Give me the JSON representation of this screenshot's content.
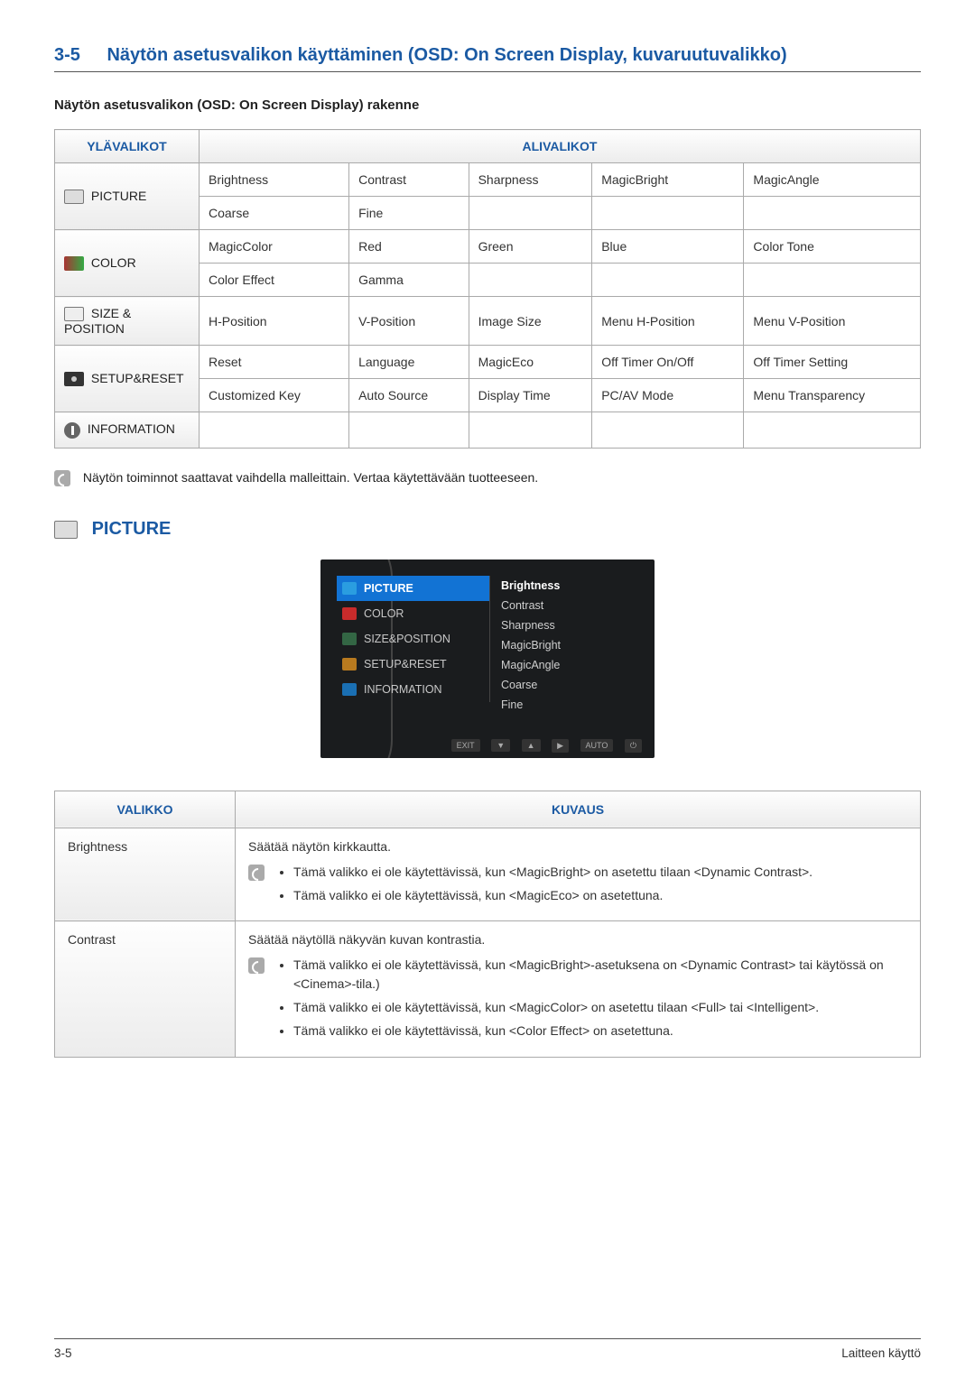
{
  "section": {
    "number": "3-5",
    "title": "Näytön asetusvalikon käyttäminen (OSD: On Screen Display, kuvaruutuvalikko)"
  },
  "subheading": "Näytön asetusvalikon (OSD: On Screen Display) rakenne",
  "struct_table": {
    "head_left": "YLÄVALIKOT",
    "head_right": "ALIVALIKOT",
    "rows": {
      "picture_label": "PICTURE",
      "picture_r1": [
        "Brightness",
        "Contrast",
        "Sharpness",
        "MagicBright",
        "MagicAngle"
      ],
      "picture_r2": [
        "Coarse",
        "Fine",
        "",
        "",
        ""
      ],
      "color_label": "COLOR",
      "color_r1": [
        "MagicColor",
        "Red",
        "Green",
        "Blue",
        "Color Tone"
      ],
      "color_r2": [
        "Color Effect",
        "Gamma",
        "",
        "",
        ""
      ],
      "size_label": "SIZE & POSITION",
      "size_r1": [
        "H-Position",
        "V-Position",
        "Image Size",
        "Menu H-Position",
        "Menu V-Position"
      ],
      "setup_label": "SETUP&RESET",
      "setup_r1": [
        "Reset",
        "Language",
        "MagicEco",
        "Off Timer On/Off",
        "Off Timer Setting"
      ],
      "setup_r2": [
        "Customized Key",
        "Auto Source",
        "Display Time",
        "PC/AV Mode",
        "Menu Transparency"
      ],
      "info_label": "INFORMATION",
      "info_r1": [
        "",
        "",
        "",
        "",
        ""
      ]
    }
  },
  "note": "Näytön toiminnot saattavat vaihdella malleittain. Vertaa käytettävään tuotteeseen.",
  "picture_heading": "PICTURE",
  "osd": {
    "left": [
      "PICTURE",
      "COLOR",
      "SIZE&POSITION",
      "SETUP&RESET",
      "INFORMATION"
    ],
    "right": [
      "Brightness",
      "Contrast",
      "Sharpness",
      "MagicBright",
      "MagicAngle",
      "Coarse",
      "Fine"
    ],
    "bottom": [
      "EXIT",
      "▼",
      "▲",
      "▶",
      "AUTO",
      "⏻"
    ]
  },
  "desc_table": {
    "head_left": "VALIKKO",
    "head_right": "KUVAUS",
    "brightness": {
      "name": "Brightness",
      "text": "Säätää näytön kirkkautta.",
      "bullets": [
        "Tämä valikko ei ole käytettävissä, kun <MagicBright> on asetettu tilaan <Dynamic Contrast>.",
        "Tämä valikko ei ole käytettävissä, kun <MagicEco> on asetettuna."
      ]
    },
    "contrast": {
      "name": "Contrast",
      "text": "Säätää näytöllä näkyvän kuvan kontrastia.",
      "bullets": [
        "Tämä valikko ei ole käytettävissä, kun <MagicBright>-asetuksena on <Dynamic Contrast> tai käytössä on <Cinema>-tila.)",
        "Tämä valikko ei ole käytettävissä, kun <MagicColor> on asetettu tilaan <Full> tai <Intelligent>.",
        "Tämä valikko ei ole käytettävissä, kun <Color Effect> on asetettuna."
      ]
    }
  },
  "footer": {
    "left": "3-5",
    "right": "Laitteen käyttö"
  }
}
